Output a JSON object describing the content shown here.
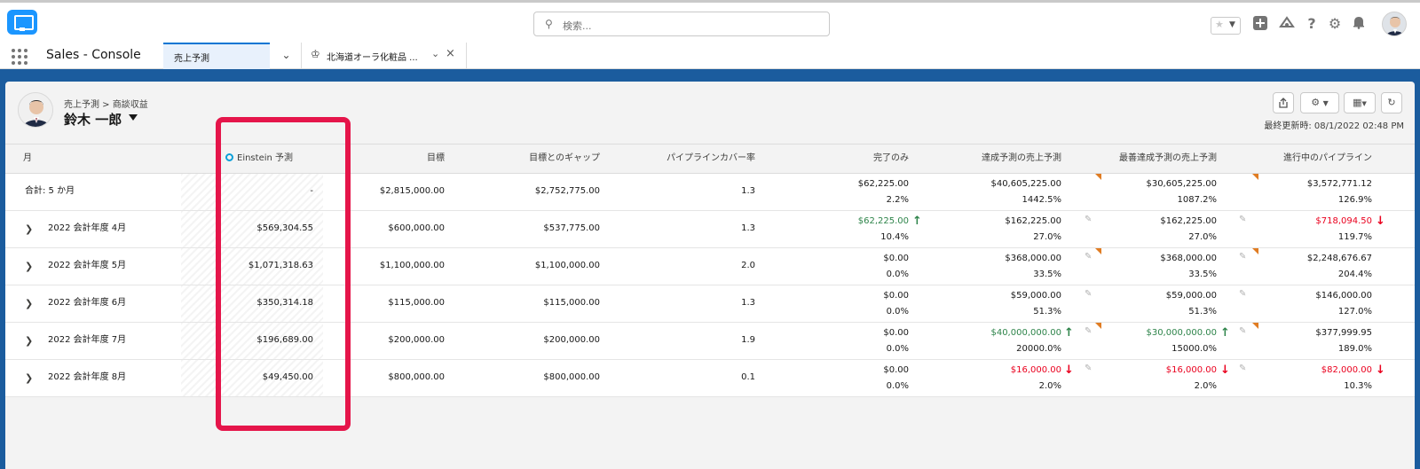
{
  "header": {
    "search_placeholder": "検索...",
    "icons": [
      "star-icon",
      "add-icon",
      "trailhead-icon",
      "help-icon",
      "setup-gear-icon",
      "notification-bell-icon"
    ]
  },
  "nav": {
    "app_name": "Sales - Console",
    "tabs": [
      {
        "label": "売上予測",
        "active": true
      },
      {
        "label": "北海道オーラ化粧品 ...",
        "active": false
      }
    ]
  },
  "forecast": {
    "breadcrumb": "売上予測 > 商談収益",
    "owner": "鈴木 一郎",
    "last_updated": "最終更新時: 08/1/2022 02:48 PM"
  },
  "table": {
    "columns": [
      "月",
      "Einstein 予測",
      "目標",
      "目標とのギャップ",
      "パイプラインカバー率",
      "完了のみ",
      "達成予測の売上予測",
      "最善達成予測の売上予測",
      "進行中のパイプライン"
    ],
    "rows": [
      {
        "month": "合計: 5 か月",
        "einstein": "-",
        "target": "$2,815,000.00",
        "gap": "$2,752,775.00",
        "coverage": "1.3",
        "closed": "$62,225.00",
        "closed_pct": "2.2%",
        "commit": "$40,605,225.00",
        "commit_pct": "1442.5%",
        "best": "$30,605,225.00",
        "best_pct": "1087.2%",
        "pipeline": "$3,572,771.12",
        "pipeline_pct": "126.9%"
      },
      {
        "month": "2022 会計年度 4月",
        "einstein": "$569,304.55",
        "target": "$600,000.00",
        "gap": "$537,775.00",
        "coverage": "1.3",
        "closed": "$62,225.00",
        "closed_pct": "10.4%",
        "commit": "$162,225.00",
        "commit_pct": "27.0%",
        "best": "$162,225.00",
        "best_pct": "27.0%",
        "pipeline": "$718,094.50",
        "pipeline_pct": "119.7%"
      },
      {
        "month": "2022 会計年度 5月",
        "einstein": "$1,071,318.63",
        "target": "$1,100,000.00",
        "gap": "$1,100,000.00",
        "coverage": "2.0",
        "closed": "$0.00",
        "closed_pct": "0.0%",
        "commit": "$368,000.00",
        "commit_pct": "33.5%",
        "best": "$368,000.00",
        "best_pct": "33.5%",
        "pipeline": "$2,248,676.67",
        "pipeline_pct": "204.4%"
      },
      {
        "month": "2022 会計年度 6月",
        "einstein": "$350,314.18",
        "target": "$115,000.00",
        "gap": "$115,000.00",
        "coverage": "1.3",
        "closed": "$0.00",
        "closed_pct": "0.0%",
        "commit": "$59,000.00",
        "commit_pct": "51.3%",
        "best": "$59,000.00",
        "best_pct": "51.3%",
        "pipeline": "$146,000.00",
        "pipeline_pct": "127.0%"
      },
      {
        "month": "2022 会計年度 7月",
        "einstein": "$196,689.00",
        "target": "$200,000.00",
        "gap": "$200,000.00",
        "coverage": "1.9",
        "closed": "$0.00",
        "closed_pct": "0.0%",
        "commit": "$40,000,000.00",
        "commit_pct": "20000.0%",
        "best": "$30,000,000.00",
        "best_pct": "15000.0%",
        "pipeline": "$377,999.95",
        "pipeline_pct": "189.0%"
      },
      {
        "month": "2022 会計年度 8月",
        "einstein": "$49,450.00",
        "target": "$800,000.00",
        "gap": "$800,000.00",
        "coverage": "0.1",
        "closed": "$0.00",
        "closed_pct": "0.0%",
        "commit": "$16,000.00",
        "commit_pct": "2.0%",
        "best": "$16,000.00",
        "best_pct": "2.0%",
        "pipeline": "$82,000.00",
        "pipeline_pct": "10.3%"
      }
    ]
  },
  "colors": {
    "up": "#2e844a",
    "down": "#ea001e",
    "highlight": "#e5154a",
    "brand": "#0176d3"
  }
}
